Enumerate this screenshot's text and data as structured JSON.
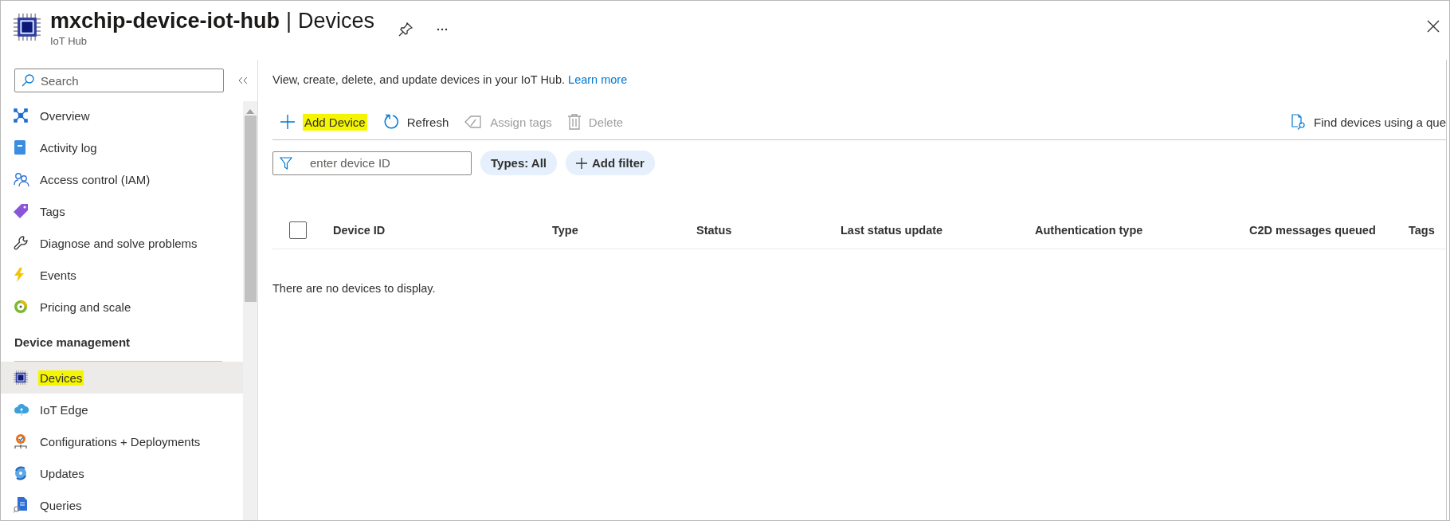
{
  "header": {
    "title": "mxchip-device-iot-hub",
    "separator": "|",
    "page": "Devices",
    "subtitle": "IoT Hub"
  },
  "sidebar": {
    "search_placeholder": "Search",
    "items": [
      {
        "kind": "item",
        "label": "Overview",
        "selected": false,
        "highlighted": false
      },
      {
        "kind": "item",
        "label": "Activity log",
        "selected": false,
        "highlighted": false
      },
      {
        "kind": "item",
        "label": "Access control (IAM)",
        "selected": false,
        "highlighted": false
      },
      {
        "kind": "item",
        "label": "Tags",
        "selected": false,
        "highlighted": false
      },
      {
        "kind": "item",
        "label": "Diagnose and solve problems",
        "selected": false,
        "highlighted": false
      },
      {
        "kind": "item",
        "label": "Events",
        "selected": false,
        "highlighted": false
      },
      {
        "kind": "item",
        "label": "Pricing and scale",
        "selected": false,
        "highlighted": false
      },
      {
        "kind": "heading",
        "label": "Device management"
      },
      {
        "kind": "item",
        "label": "Devices",
        "selected": true,
        "highlighted": true
      },
      {
        "kind": "item",
        "label": "IoT Edge",
        "selected": false,
        "highlighted": false
      },
      {
        "kind": "item",
        "label": "Configurations + Deployments",
        "selected": false,
        "highlighted": false
      },
      {
        "kind": "item",
        "label": "Updates",
        "selected": false,
        "highlighted": false
      },
      {
        "kind": "item",
        "label": "Queries",
        "selected": false,
        "highlighted": false
      }
    ]
  },
  "description": "View, create, delete, and update devices in your IoT Hub.",
  "learn_more": "Learn more",
  "toolbar": {
    "actions": [
      {
        "label": "Add Device",
        "disabled": false,
        "highlighted": true
      },
      {
        "label": "Refresh",
        "disabled": false,
        "highlighted": false
      },
      {
        "label": "Assign tags",
        "disabled": true,
        "highlighted": false
      },
      {
        "label": "Delete",
        "disabled": true,
        "highlighted": false
      }
    ],
    "query_action": "Find devices using a que"
  },
  "filter": {
    "placeholder": "enter device ID",
    "pills": [
      "Types: All",
      "Add filter"
    ]
  },
  "table": {
    "select_all_checked": false,
    "columns": [
      "Device ID",
      "Type",
      "Status",
      "Last status update",
      "Authentication type",
      "C2D messages queued",
      "Tags"
    ],
    "empty_message": "There are no devices to display."
  }
}
